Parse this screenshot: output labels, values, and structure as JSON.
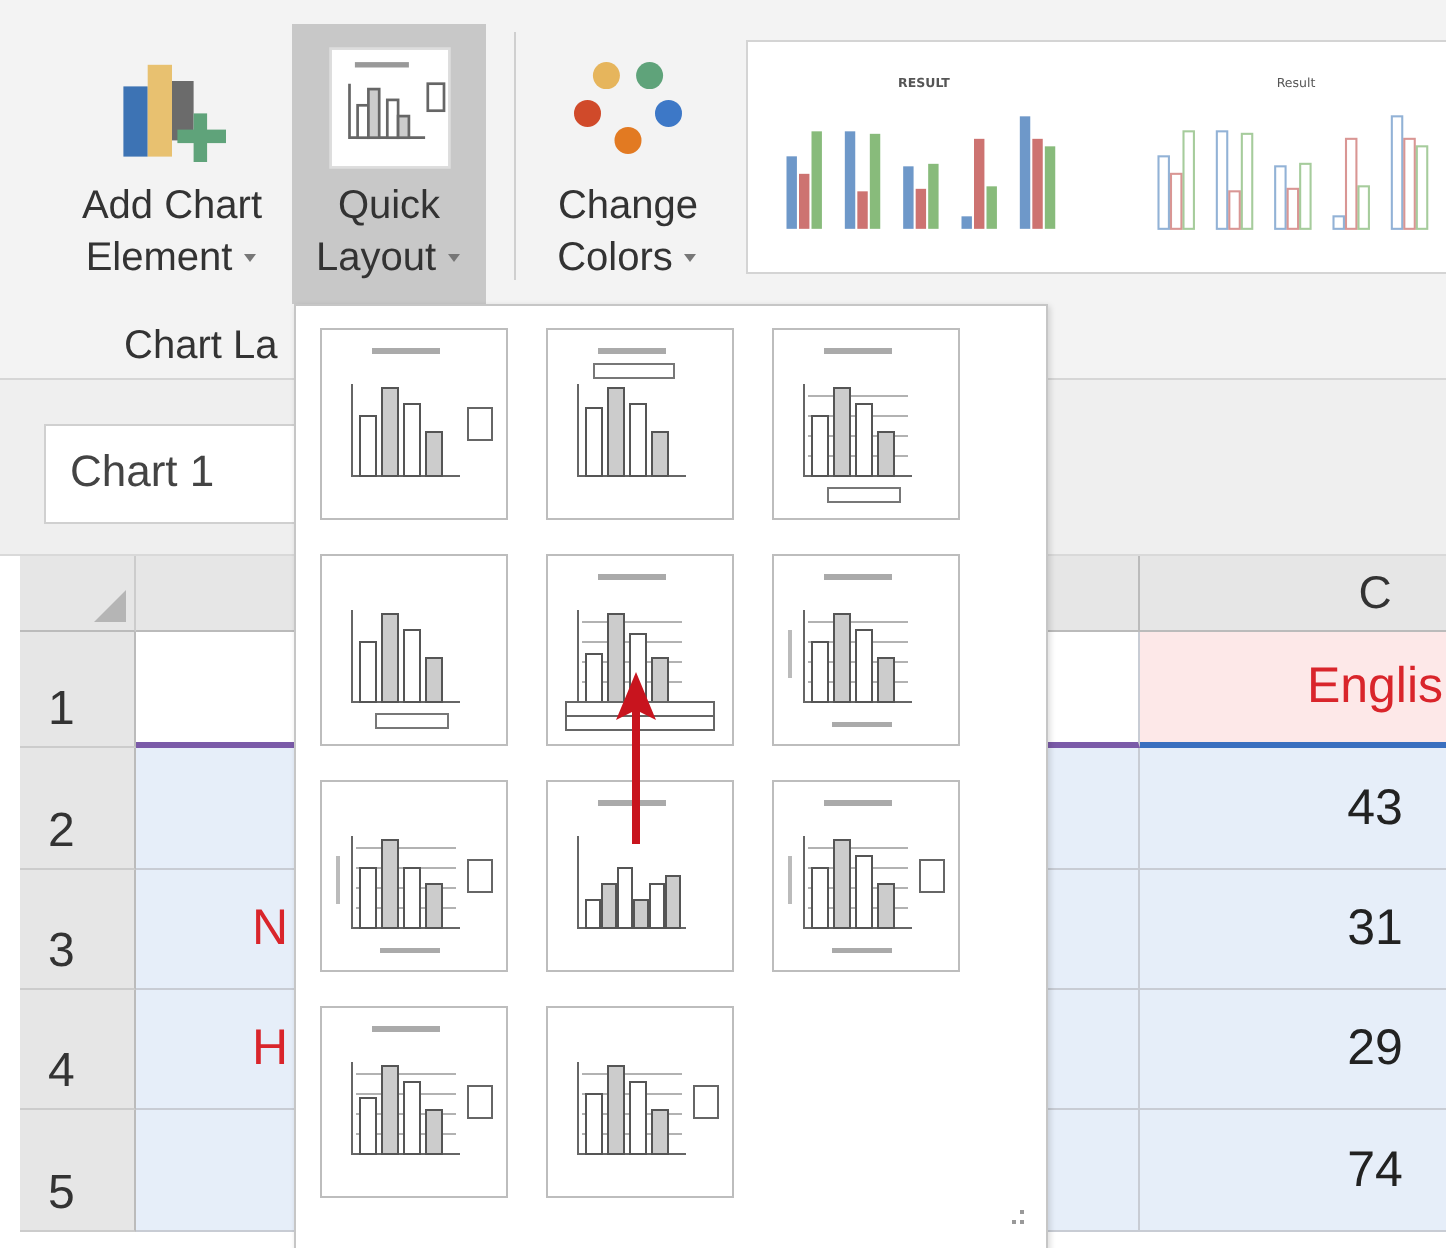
{
  "ribbon": {
    "buttons": [
      {
        "kind": "add-element",
        "lines": [
          "Add Chart",
          "Element"
        ],
        "selected": false
      },
      {
        "kind": "quick-layout",
        "lines": [
          "Quick",
          "Layout"
        ],
        "selected": true
      },
      {
        "kind": "change-colors",
        "lines": [
          "Change",
          "Colors"
        ],
        "selected": false
      }
    ],
    "group_label": "Chart La",
    "chart_styles": [
      {
        "title": "RESULT",
        "kind": "filled"
      },
      {
        "title": "Result",
        "kind": "outline"
      }
    ]
  },
  "name_box": {
    "value": "Chart 1"
  },
  "sheet": {
    "column_header": "C",
    "rows": [
      {
        "header": "1",
        "kind": "header",
        "column_b": "",
        "column_c": "Englis"
      },
      {
        "header": "2",
        "kind": "data",
        "column_b": "",
        "column_c": "43"
      },
      {
        "header": "3",
        "kind": "data",
        "column_b": "N",
        "column_c": "31"
      },
      {
        "header": "4",
        "kind": "data",
        "column_b": "H",
        "column_c": "29"
      },
      {
        "header": "5",
        "kind": "data",
        "column_b": "",
        "column_c": "74"
      }
    ]
  }
}
